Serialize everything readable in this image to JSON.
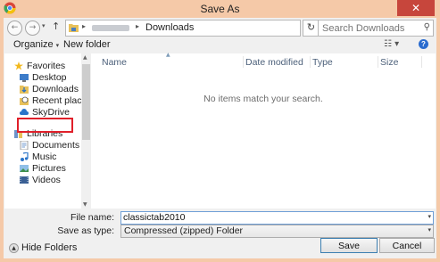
{
  "window": {
    "title": "Save As",
    "close_glyph": "✕",
    "icon": "chrome-icon"
  },
  "navigation": {
    "back_glyph": "←",
    "forward_glyph": "→",
    "recent_glyph": "▾",
    "up_glyph": "↑",
    "address_separator": "▸",
    "address_current": "Downloads",
    "address_dropdown_glyph": "▾",
    "refresh_glyph": "↻",
    "search_placeholder": "Search Downloads",
    "search_glyph": "⚲"
  },
  "toolbar": {
    "organize_label": "Organize",
    "dropdown_glyph": "▾",
    "new_folder_label": "New folder",
    "views_glyph": "☷ ▾",
    "help_glyph": "?"
  },
  "sidebar": {
    "favorites": {
      "label": "Favorites",
      "items": [
        {
          "label": "Desktop"
        },
        {
          "label": "Downloads"
        },
        {
          "label": "Recent places"
        },
        {
          "label": "SkyDrive"
        }
      ]
    },
    "libraries": {
      "label": "Libraries",
      "items": [
        {
          "label": "Documents"
        },
        {
          "label": "Music"
        },
        {
          "label": "Pictures"
        },
        {
          "label": "Videos"
        }
      ]
    },
    "scroll_up_glyph": "▲",
    "scroll_down_glyph": "▼"
  },
  "file_list": {
    "columns": [
      "Name",
      "Date modified",
      "Type",
      "Size"
    ],
    "sort_glyph": "▲",
    "empty_message": "No items match your search."
  },
  "form": {
    "file_name_label": "File name:",
    "file_name_value": "classictab2010",
    "save_type_label": "Save as type:",
    "save_type_value": "Compressed (zipped) Folder",
    "dropdown_glyph": "▾"
  },
  "footer": {
    "hide_folders_glyph": "▲",
    "hide_folders_label": "Hide Folders",
    "save_label": "Save",
    "cancel_label": "Cancel"
  },
  "colors": {
    "title_bar": "#f5c9a8",
    "close_button": "#c7463c",
    "highlight_box": "#e0202a"
  }
}
